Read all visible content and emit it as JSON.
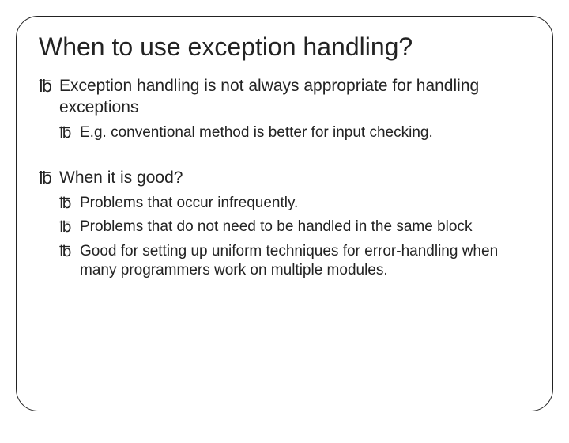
{
  "title": "When to use exception handling?",
  "bullet_glyph": "℔",
  "items": [
    {
      "text": "Exception handling is not always appropriate for handling exceptions",
      "sub": [
        {
          "text": "E.g. conventional method is better for input checking."
        }
      ]
    },
    {
      "text": "When it is good?",
      "sub": [
        {
          "text": "Problems that occur infrequently."
        },
        {
          "text": "Problems that do not need to be handled in the same block"
        },
        {
          "text": "Good for setting up uniform techniques for error-handling when many programmers work on multiple modules."
        }
      ]
    }
  ]
}
